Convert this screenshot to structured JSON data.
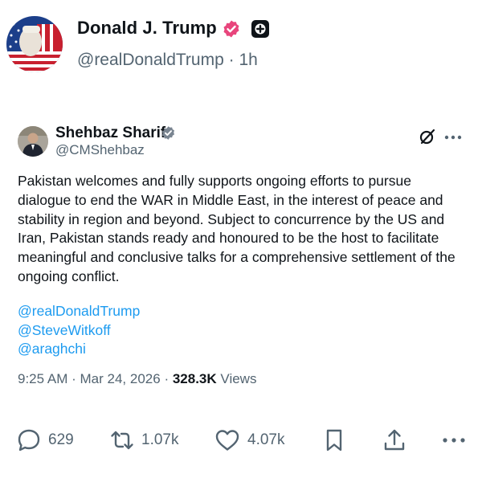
{
  "post": {
    "author_name": "Donald J. Trump",
    "handle": "@realDonaldTrump",
    "separator": "·",
    "time_ago": "1h"
  },
  "quote": {
    "author_name": "Shehbaz Sharif",
    "handle": "@CMShehbaz",
    "text": "Pakistan welcomes and fully supports ongoing efforts to pursue dialogue to end the WAR in Middle East, in the interest of peace and stability in region and beyond. Subject to concurrence by the US and Iran, Pakistan stands ready and honoured to be the host to facilitate meaningful and conclusive talks for a comprehensive settlement of the ongoing conflict.",
    "mentions": [
      "@realDonaldTrump",
      "@SteveWitkoff",
      "@araghchi"
    ],
    "time": "9:25 AM",
    "date": "Mar 24, 2026",
    "meta_separator": "·",
    "views_count": "328.3K",
    "views_label": "Views"
  },
  "actions": {
    "replies": "629",
    "reposts": "1.07k",
    "likes": "4.07k"
  },
  "icons": {
    "verified_pink": "verified-badge-pink",
    "plus_badge": "plus-badge",
    "verified_gray": "verified-badge-gray",
    "grok": "grok-icon",
    "more": "more-icon",
    "reply": "reply-icon",
    "repost": "repost-icon",
    "like": "heart-icon",
    "bookmark": "bookmark-icon",
    "share": "share-icon"
  },
  "colors": {
    "text": "#0f1419",
    "secondary": "#536471",
    "link": "#1d9bf0",
    "verified_pink": "#e8457c"
  }
}
